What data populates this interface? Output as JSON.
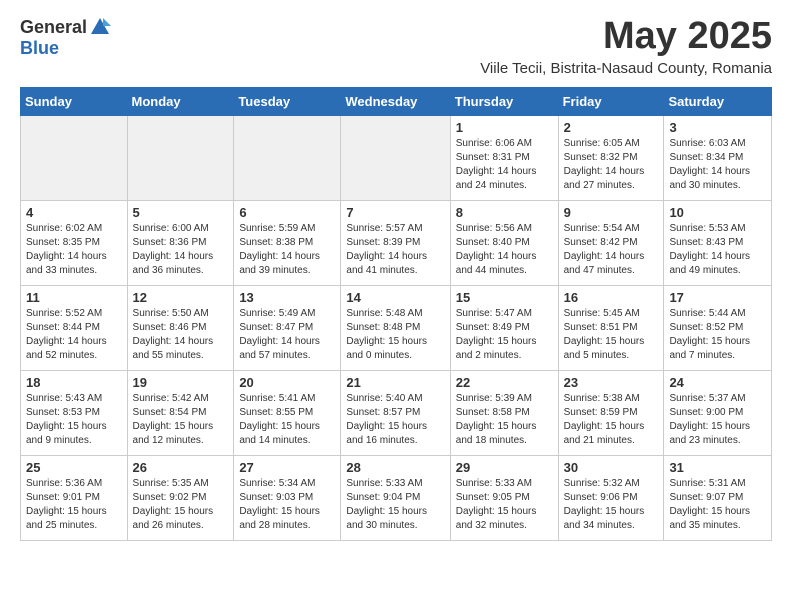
{
  "logo": {
    "general": "General",
    "blue": "Blue"
  },
  "header": {
    "month": "May 2025",
    "subtitle": "Viile Tecii, Bistrita-Nasaud County, Romania"
  },
  "weekdays": [
    "Sunday",
    "Monday",
    "Tuesday",
    "Wednesday",
    "Thursday",
    "Friday",
    "Saturday"
  ],
  "weeks": [
    [
      {
        "day": "",
        "empty": true
      },
      {
        "day": "",
        "empty": true
      },
      {
        "day": "",
        "empty": true
      },
      {
        "day": "",
        "empty": true
      },
      {
        "day": "1",
        "sunrise": "6:06 AM",
        "sunset": "8:31 PM",
        "daylight": "14 hours and 24 minutes."
      },
      {
        "day": "2",
        "sunrise": "6:05 AM",
        "sunset": "8:32 PM",
        "daylight": "14 hours and 27 minutes."
      },
      {
        "day": "3",
        "sunrise": "6:03 AM",
        "sunset": "8:34 PM",
        "daylight": "14 hours and 30 minutes."
      }
    ],
    [
      {
        "day": "4",
        "sunrise": "6:02 AM",
        "sunset": "8:35 PM",
        "daylight": "14 hours and 33 minutes."
      },
      {
        "day": "5",
        "sunrise": "6:00 AM",
        "sunset": "8:36 PM",
        "daylight": "14 hours and 36 minutes."
      },
      {
        "day": "6",
        "sunrise": "5:59 AM",
        "sunset": "8:38 PM",
        "daylight": "14 hours and 39 minutes."
      },
      {
        "day": "7",
        "sunrise": "5:57 AM",
        "sunset": "8:39 PM",
        "daylight": "14 hours and 41 minutes."
      },
      {
        "day": "8",
        "sunrise": "5:56 AM",
        "sunset": "8:40 PM",
        "daylight": "14 hours and 44 minutes."
      },
      {
        "day": "9",
        "sunrise": "5:54 AM",
        "sunset": "8:42 PM",
        "daylight": "14 hours and 47 minutes."
      },
      {
        "day": "10",
        "sunrise": "5:53 AM",
        "sunset": "8:43 PM",
        "daylight": "14 hours and 49 minutes."
      }
    ],
    [
      {
        "day": "11",
        "sunrise": "5:52 AM",
        "sunset": "8:44 PM",
        "daylight": "14 hours and 52 minutes."
      },
      {
        "day": "12",
        "sunrise": "5:50 AM",
        "sunset": "8:46 PM",
        "daylight": "14 hours and 55 minutes."
      },
      {
        "day": "13",
        "sunrise": "5:49 AM",
        "sunset": "8:47 PM",
        "daylight": "14 hours and 57 minutes."
      },
      {
        "day": "14",
        "sunrise": "5:48 AM",
        "sunset": "8:48 PM",
        "daylight": "15 hours and 0 minutes."
      },
      {
        "day": "15",
        "sunrise": "5:47 AM",
        "sunset": "8:49 PM",
        "daylight": "15 hours and 2 minutes."
      },
      {
        "day": "16",
        "sunrise": "5:45 AM",
        "sunset": "8:51 PM",
        "daylight": "15 hours and 5 minutes."
      },
      {
        "day": "17",
        "sunrise": "5:44 AM",
        "sunset": "8:52 PM",
        "daylight": "15 hours and 7 minutes."
      }
    ],
    [
      {
        "day": "18",
        "sunrise": "5:43 AM",
        "sunset": "8:53 PM",
        "daylight": "15 hours and 9 minutes."
      },
      {
        "day": "19",
        "sunrise": "5:42 AM",
        "sunset": "8:54 PM",
        "daylight": "15 hours and 12 minutes."
      },
      {
        "day": "20",
        "sunrise": "5:41 AM",
        "sunset": "8:55 PM",
        "daylight": "15 hours and 14 minutes."
      },
      {
        "day": "21",
        "sunrise": "5:40 AM",
        "sunset": "8:57 PM",
        "daylight": "15 hours and 16 minutes."
      },
      {
        "day": "22",
        "sunrise": "5:39 AM",
        "sunset": "8:58 PM",
        "daylight": "15 hours and 18 minutes."
      },
      {
        "day": "23",
        "sunrise": "5:38 AM",
        "sunset": "8:59 PM",
        "daylight": "15 hours and 21 minutes."
      },
      {
        "day": "24",
        "sunrise": "5:37 AM",
        "sunset": "9:00 PM",
        "daylight": "15 hours and 23 minutes."
      }
    ],
    [
      {
        "day": "25",
        "sunrise": "5:36 AM",
        "sunset": "9:01 PM",
        "daylight": "15 hours and 25 minutes."
      },
      {
        "day": "26",
        "sunrise": "5:35 AM",
        "sunset": "9:02 PM",
        "daylight": "15 hours and 26 minutes."
      },
      {
        "day": "27",
        "sunrise": "5:34 AM",
        "sunset": "9:03 PM",
        "daylight": "15 hours and 28 minutes."
      },
      {
        "day": "28",
        "sunrise": "5:33 AM",
        "sunset": "9:04 PM",
        "daylight": "15 hours and 30 minutes."
      },
      {
        "day": "29",
        "sunrise": "5:33 AM",
        "sunset": "9:05 PM",
        "daylight": "15 hours and 32 minutes."
      },
      {
        "day": "30",
        "sunrise": "5:32 AM",
        "sunset": "9:06 PM",
        "daylight": "15 hours and 34 minutes."
      },
      {
        "day": "31",
        "sunrise": "5:31 AM",
        "sunset": "9:07 PM",
        "daylight": "15 hours and 35 minutes."
      }
    ]
  ]
}
